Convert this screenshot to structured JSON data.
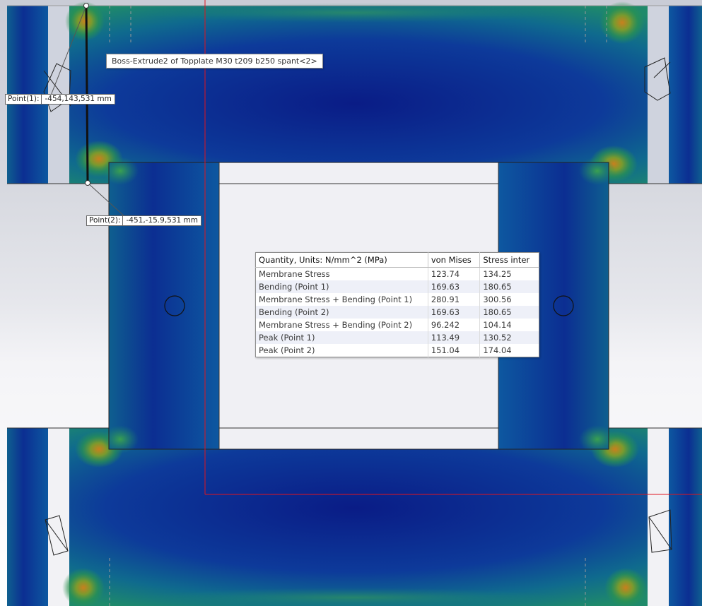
{
  "tooltip": {
    "text": "Boss-Extrude2 of Topplate M30 t209 b250 spant<2>"
  },
  "points": [
    {
      "name": "Point(1):",
      "value": "-454,143,531 mm"
    },
    {
      "name": "Point(2):",
      "value": "-451,-15.9,531 mm"
    }
  ],
  "stress_table": {
    "headers": [
      "Quantity, Units: N/mm^2 (MPa)",
      "von Mises",
      "Stress inter"
    ],
    "rows": [
      {
        "quantity": "Membrane Stress",
        "von_mises": "123.74",
        "stress_inter": "134.25"
      },
      {
        "quantity": "Bending (Point 1)",
        "von_mises": "169.63",
        "stress_inter": "180.65"
      },
      {
        "quantity": "Membrane Stress + Bending (Point 1)",
        "von_mises": "280.91",
        "stress_inter": "300.56"
      },
      {
        "quantity": "Bending (Point 2)",
        "von_mises": "169.63",
        "stress_inter": "180.65"
      },
      {
        "quantity": "Membrane Stress + Bending (Point 2)",
        "von_mises": "96.242",
        "stress_inter": "104.14"
      },
      {
        "quantity": "Peak (Point 1)",
        "von_mises": "113.49",
        "stress_inter": "130.52"
      },
      {
        "quantity": "Peak (Point 2)",
        "von_mises": "151.04",
        "stress_inter": "174.04"
      }
    ]
  },
  "colors": {
    "stress_low": "#0a1f8a",
    "stress_mid": "#0e6d8c",
    "stress_high": "#2f9a4a",
    "stress_peak": "#b07a20",
    "section_plane": "#e0141e",
    "background_top": "#c9ccd6",
    "background_bottom": "#ffffff"
  }
}
